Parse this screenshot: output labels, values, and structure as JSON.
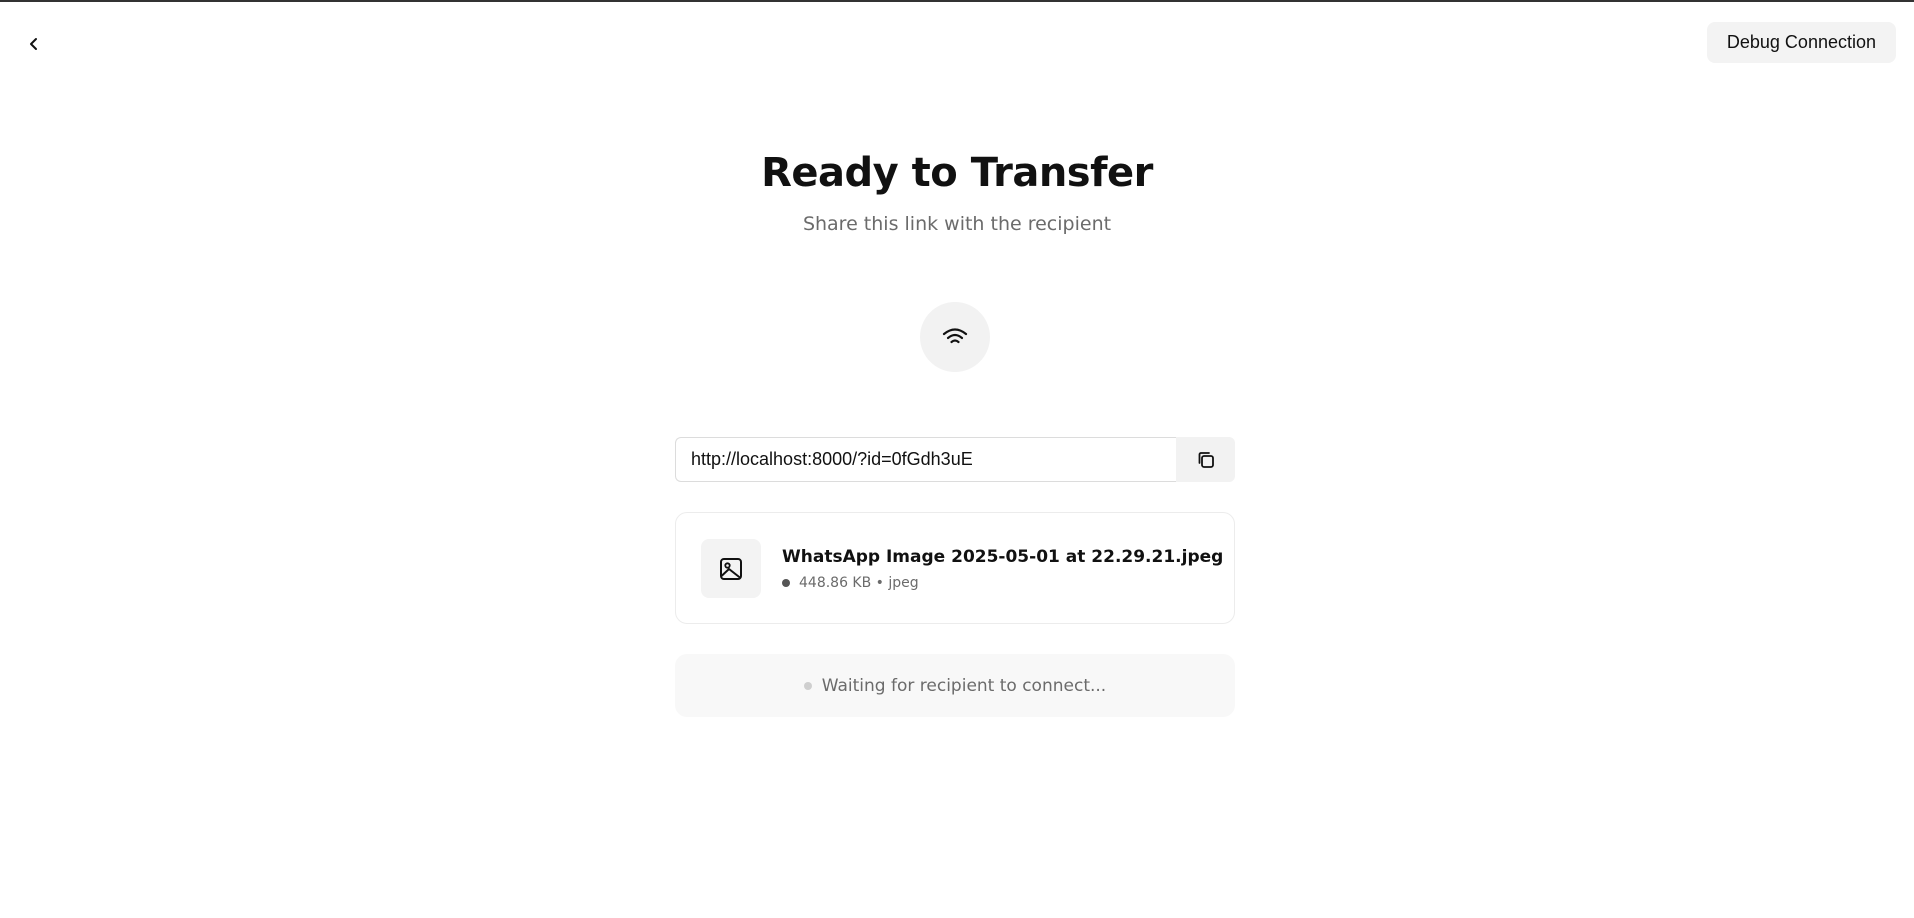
{
  "header": {
    "back_icon": "chevron-left-icon",
    "debug_button_label": "Debug Connection"
  },
  "main": {
    "title": "Ready to Transfer",
    "subtitle": "Share this link with the recipient",
    "status_icon": "wifi-icon"
  },
  "link": {
    "value": "http://localhost:8000/?id=0fGdh3uE",
    "copy_icon": "copy-icon"
  },
  "file": {
    "icon": "image-icon",
    "name": "WhatsApp Image 2025-05-01 at 22.29.21.jpeg",
    "size": "448.86 KB",
    "type": "jpeg",
    "meta_text": "448.86 KB • jpeg"
  },
  "status": {
    "text": "Waiting for recipient to connect..."
  },
  "colors": {
    "background": "#ffffff",
    "surface": "#f3f3f3",
    "text_primary": "#111111",
    "text_secondary": "#6b6b6b"
  }
}
